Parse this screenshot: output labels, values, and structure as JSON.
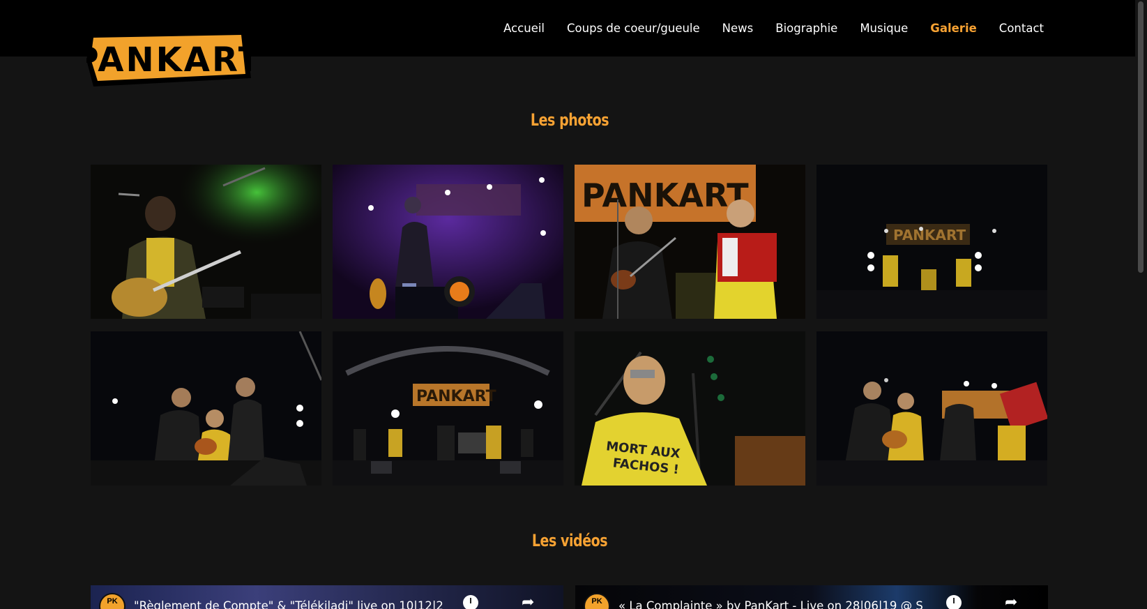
{
  "brand": {
    "logo_text": "PANKART"
  },
  "nav": {
    "items": [
      {
        "label": "Accueil",
        "active": false
      },
      {
        "label": "Coups de coeur/gueule",
        "active": false
      },
      {
        "label": "News",
        "active": false
      },
      {
        "label": "Biographie",
        "active": false
      },
      {
        "label": "Musique",
        "active": false
      },
      {
        "label": "Galerie",
        "active": true
      },
      {
        "label": "Contact",
        "active": false
      }
    ]
  },
  "photos_section": {
    "title": "Les photos"
  },
  "photos": [
    {
      "subject": "guitarist-green-light"
    },
    {
      "subject": "singer-purple-stage"
    },
    {
      "subject": "mandolin-accordion-banner"
    },
    {
      "subject": "band-dark-stage"
    },
    {
      "subject": "three-guitarists"
    },
    {
      "subject": "full-band-banner"
    },
    {
      "subject": "harmonica-player"
    },
    {
      "subject": "band-accordion-right"
    }
  ],
  "videos_section": {
    "title": "Les vidéos"
  },
  "videos": [
    {
      "title": "\"Règlement de Compte\" & \"Télékiladi\" live on 10|12|2",
      "avatar_text": "PK"
    },
    {
      "title": "« La Complainte » by PanKart - Live on 28|06|19 @ S",
      "avatar_text": "PK"
    }
  ],
  "colors": {
    "accent": "#f7a233",
    "background": "#141414",
    "header": "#000000",
    "logo_yellow": "#f2a22b"
  }
}
